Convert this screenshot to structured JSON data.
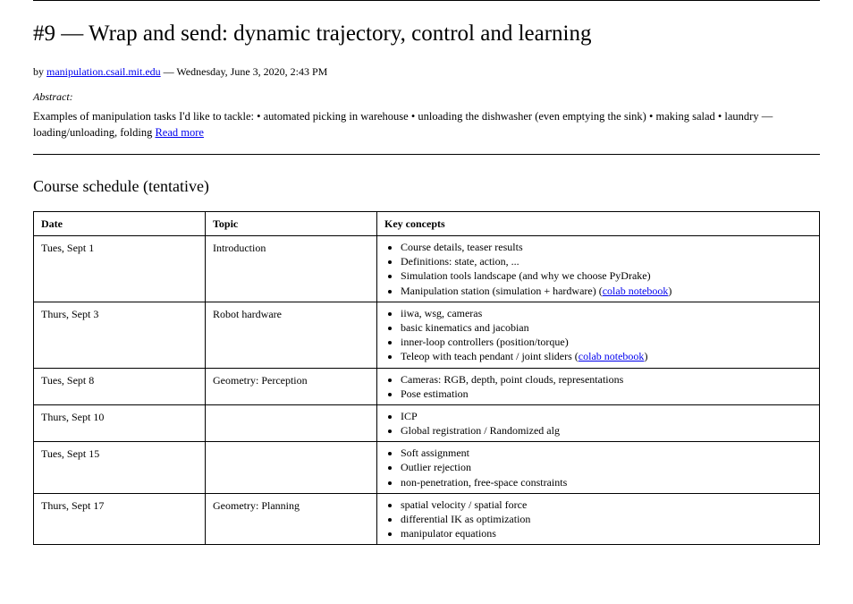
{
  "section": {
    "title": "#9 — Wrap and send: dynamic trajectory, control and learning",
    "by_prefix": "by ",
    "by_name": "manipulation.csail.mit.edu",
    "by_date": " — Wednesday, June 3, 2020, 2:43 PM",
    "abstract_label": "Abstract:",
    "abstract_prefix": "Examples of manipulation tasks I'd like to tackle: • automated picking in warehouse • unloading the dishwasher (even emptying the sink) • making salad • laundry — loading/unloading, folding ",
    "abstract_link_text": "Read more",
    "abstract_link_href": "#"
  },
  "schedule": {
    "heading": "Course schedule (tentative)",
    "columns": [
      "Date",
      "Topic",
      "Key concepts"
    ],
    "rows": [
      {
        "date": "Tues, Sept 1",
        "topic": "Introduction",
        "concepts": [
          {
            "text": "Course details, teaser results"
          },
          {
            "text": "Definitions: state, action, ..."
          },
          {
            "text": "Simulation tools landscape (and why we choose PyDrake)"
          },
          {
            "text": "Manipulation station (simulation + hardware) (",
            "link_text": "colab notebook",
            "suffix": ")"
          }
        ]
      },
      {
        "date": "Thurs, Sept 3",
        "topic": "Robot hardware",
        "concepts": [
          {
            "text": "iiwa, wsg, cameras"
          },
          {
            "text": "basic kinematics and jacobian"
          },
          {
            "text": "inner-loop controllers (position/torque)"
          },
          {
            "text": "Teleop with teach pendant / joint sliders (",
            "link_text": "colab notebook",
            "suffix": ")"
          }
        ]
      },
      {
        "date": "Tues, Sept 8",
        "topic": "Geometry: Perception",
        "concepts": [
          {
            "text": "Cameras: RGB, depth, point clouds, representations"
          },
          {
            "text": "Pose estimation"
          }
        ]
      },
      {
        "date": "Thurs, Sept 10",
        "topic": "",
        "concepts": [
          {
            "text": "ICP"
          },
          {
            "text": "Global registration / Randomized alg"
          }
        ]
      },
      {
        "date": "Tues, Sept 15",
        "topic": "",
        "concepts": [
          {
            "text": "Soft assignment"
          },
          {
            "text": "Outlier rejection"
          },
          {
            "text": "non-penetration, free-space constraints"
          }
        ]
      },
      {
        "date": "Thurs, Sept 17",
        "topic": "Geometry: Planning",
        "concepts": [
          {
            "text": "spatial velocity / spatial force"
          },
          {
            "text": "differential IK as optimization"
          },
          {
            "text": "manipulator equations"
          }
        ]
      }
    ]
  }
}
